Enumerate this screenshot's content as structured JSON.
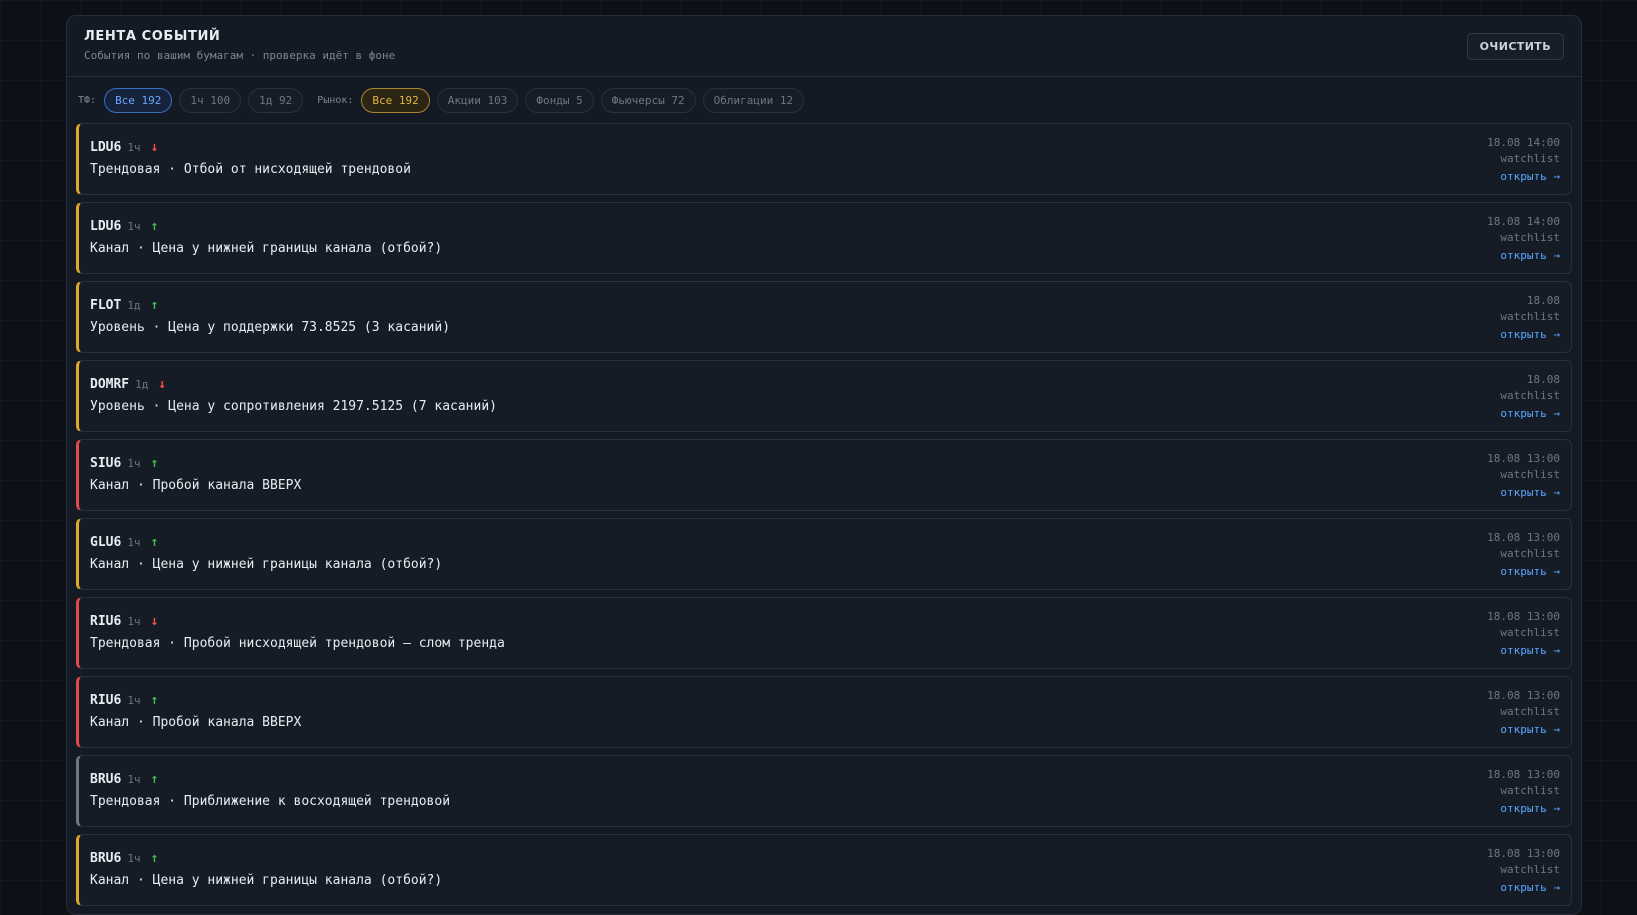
{
  "header": {
    "title": "ЛЕНТА СОБЫТИЙ",
    "subtitle": "События по вашим бумагам · проверка идёт в фоне",
    "clear_label": "ОЧИСТИТЬ"
  },
  "filters": {
    "tf_label": "ТФ:",
    "tf_chips": [
      "Все 192",
      "1ч 100",
      "1д 92"
    ],
    "market_label": "Рынок:",
    "market_chips": [
      "Все 192",
      "Акции 103",
      "Фонды 5",
      "Фьючерсы 72",
      "Облигации 12"
    ]
  },
  "colors": {
    "accent_yellow": "#e3a82b",
    "accent_red": "#e5484d",
    "accent_gray": "#6e7681",
    "up": "#3fb950",
    "down": "#f85149",
    "link": "#58a6ff"
  },
  "events": [
    {
      "ticker": "LDU6",
      "tf": "1ч",
      "dir": "↓",
      "text": "Трендовая · Отбой от нисходящей трендовой",
      "time": "18.08 14:00",
      "source": "watchlist",
      "open": "открыть →"
    },
    {
      "ticker": "LDU6",
      "tf": "1ч",
      "dir": "↑",
      "text": "Канал · Цена у нижней границы канала (отбой?)",
      "time": "18.08 14:00",
      "source": "watchlist",
      "open": "открыть →"
    },
    {
      "ticker": "FLOT",
      "tf": "1д",
      "dir": "↑",
      "text": "Уровень · Цена у поддержки 73.8525 (3 касаний)",
      "time": "18.08",
      "source": "watchlist",
      "open": "открыть →"
    },
    {
      "ticker": "DOMRF",
      "tf": "1д",
      "dir": "↓",
      "text": "Уровень · Цена у сопротивления 2197.5125 (7 касаний)",
      "time": "18.08",
      "source": "watchlist",
      "open": "открыть →"
    },
    {
      "ticker": "SIU6",
      "tf": "1ч",
      "dir": "↑",
      "text": "Канал · Пробой канала ВВЕРХ",
      "time": "18.08 13:00",
      "source": "watchlist",
      "open": "открыть →"
    },
    {
      "ticker": "GLU6",
      "tf": "1ч",
      "dir": "↑",
      "text": "Канал · Цена у нижней границы канала (отбой?)",
      "time": "18.08 13:00",
      "source": "watchlist",
      "open": "открыть →"
    },
    {
      "ticker": "RIU6",
      "tf": "1ч",
      "dir": "↓",
      "text": "Трендовая · Пробой нисходящей трендовой — слом тренда",
      "time": "18.08 13:00",
      "source": "watchlist",
      "open": "открыть →"
    },
    {
      "ticker": "RIU6",
      "tf": "1ч",
      "dir": "↑",
      "text": "Канал · Пробой канала ВВЕРХ",
      "time": "18.08 13:00",
      "source": "watchlist",
      "open": "открыть →"
    },
    {
      "ticker": "BRU6",
      "tf": "1ч",
      "dir": "↑",
      "text": "Трендовая · Приближение к восходящей трендовой",
      "time": "18.08 13:00",
      "source": "watchlist",
      "open": "открыть →"
    },
    {
      "ticker": "BRU6",
      "tf": "1ч",
      "dir": "↑",
      "text": "Канал · Цена у нижней границы канала (отбой?)",
      "time": "18.08 13:00",
      "source": "watchlist",
      "open": "открыть →"
    }
  ]
}
